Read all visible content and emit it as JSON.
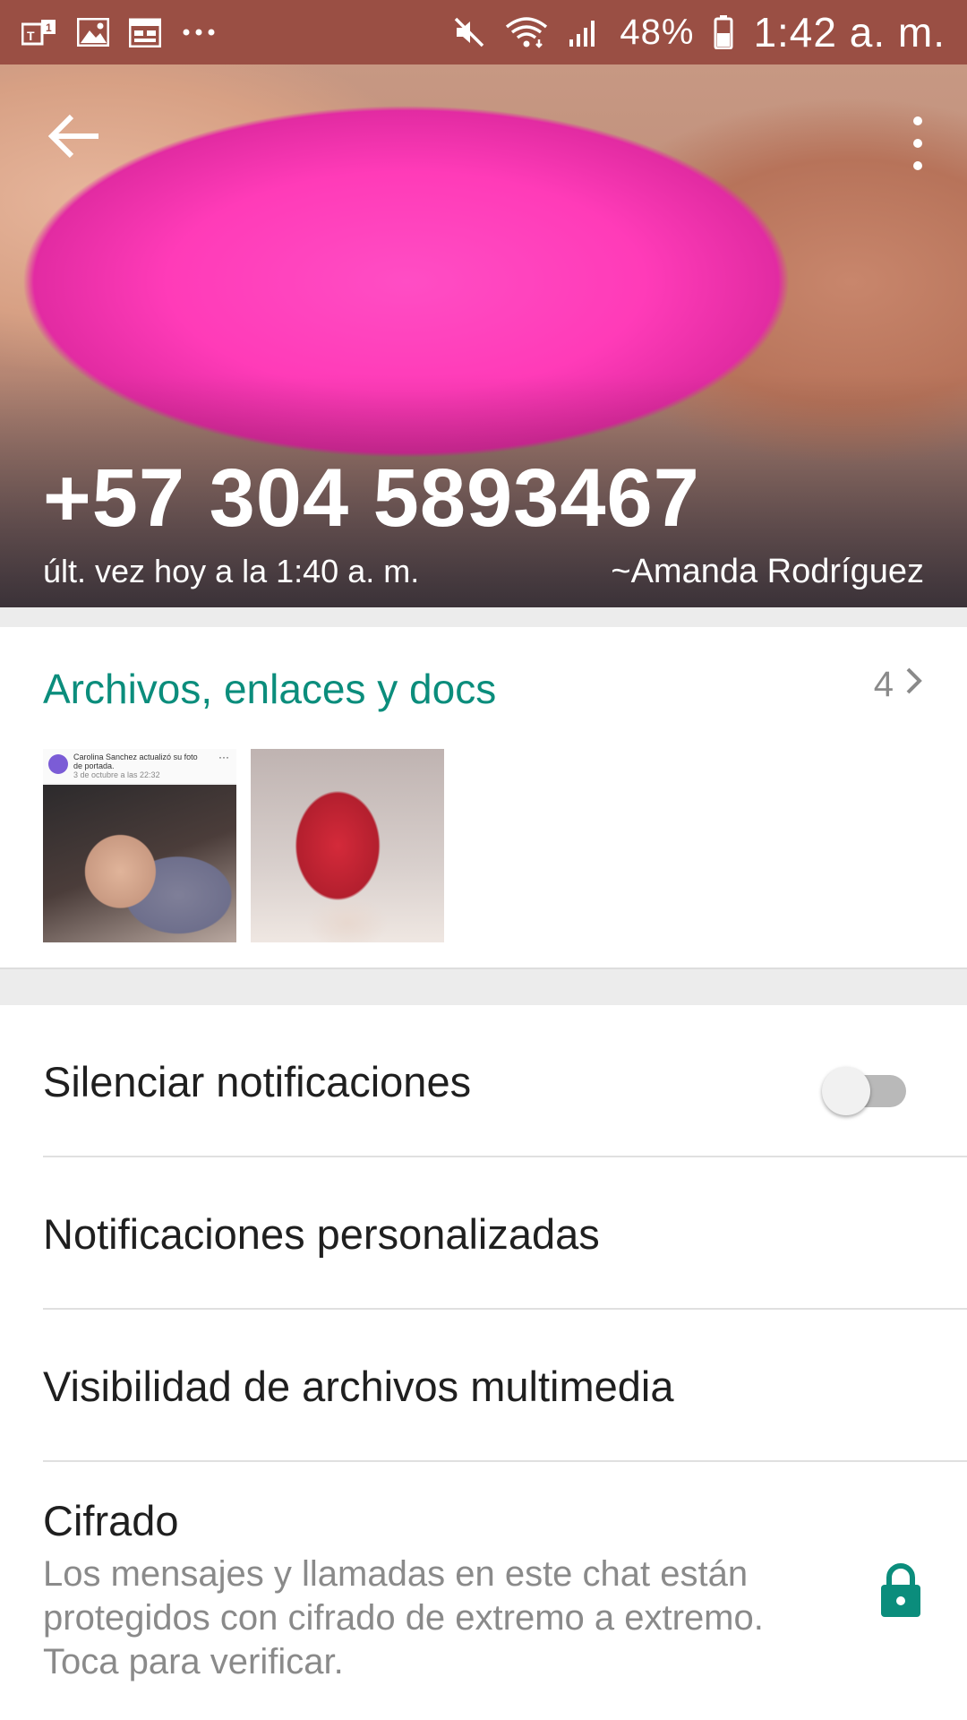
{
  "status_bar": {
    "battery": "48%",
    "time": "1:42 a. m.",
    "left_icons": [
      "teams-notification-icon",
      "image-icon",
      "calendar-icon",
      "more-notifications-icon"
    ],
    "right_icons": [
      "mute-icon",
      "wifi-icon",
      "signal-icon",
      "battery-icon"
    ],
    "color": "#9a4f44"
  },
  "contact": {
    "phone": "+57 304 5893467",
    "last_seen": "últ. vez hoy a la 1:40 a. m.",
    "push_name": "~Amanda Rodríguez"
  },
  "media": {
    "title": "Archivos, enlaces y docs",
    "count": "4",
    "accent": "#0b8d7c",
    "thumb1_caption": "Carolina Sanchez actualizó su foto de portada.",
    "thumb1_date": "3 de octubre a las 22:32"
  },
  "settings": {
    "mute": {
      "label": "Silenciar notificaciones",
      "enabled": false
    },
    "custom_notifications": "Notificaciones personalizadas",
    "media_visibility": "Visibilidad de archivos multimedia",
    "encryption": {
      "title": "Cifrado",
      "description": "Los mensajes y llamadas en este chat están protegidos con cifrado de extremo a extremo. Toca para verificar."
    }
  }
}
